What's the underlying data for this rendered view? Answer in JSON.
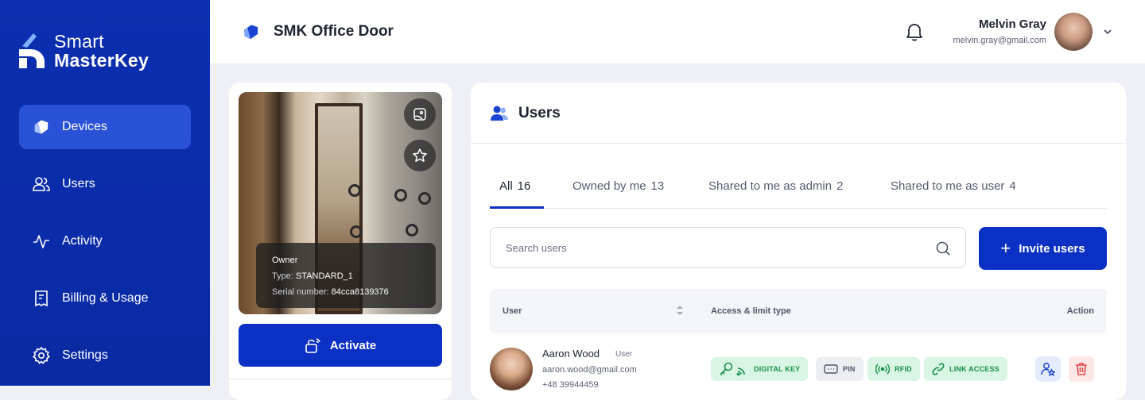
{
  "brand": {
    "line1": "Smart",
    "line2": "MasterKey"
  },
  "nav": {
    "items": [
      {
        "label": "Devices",
        "icon": "devices-icon",
        "active": true
      },
      {
        "label": "Users",
        "icon": "users-icon"
      },
      {
        "label": "Activity",
        "icon": "activity-icon"
      },
      {
        "label": "Billing & Usage",
        "icon": "billing-icon"
      },
      {
        "label": "Settings",
        "icon": "gear-icon"
      }
    ]
  },
  "header": {
    "device_title": "SMK Office Door",
    "user_name": "Melvin Gray",
    "user_email": "melvin.gray@gmail.com"
  },
  "device_card": {
    "owner_label": "Owner",
    "type_label": "Type:",
    "type_value": "STANDARD_1",
    "serial_label": "Serial number:",
    "serial_value": "84cca8139376",
    "activate_label": "Activate"
  },
  "users_panel": {
    "title": "Users",
    "tabs": [
      {
        "label": "All",
        "count": "16",
        "active": true
      },
      {
        "label": "Owned by me",
        "count": "13"
      },
      {
        "label": "Shared to me as admin",
        "count": "2"
      },
      {
        "label": "Shared to me as user",
        "count": "4"
      }
    ],
    "search_placeholder": "Search users",
    "invite_label": "Invite users",
    "columns": {
      "user": "User",
      "access": "Access & limit type",
      "action": "Action"
    },
    "rows": [
      {
        "name": "Aaron Wood",
        "role": "User",
        "email": "aaron.wood@gmail.com",
        "phone": "+48 39944459",
        "badges": [
          {
            "label": "DIGITAL KEY",
            "style": "green"
          },
          {
            "label": "PIN",
            "style": "gray"
          },
          {
            "label": "RFID",
            "style": "green"
          },
          {
            "label": "LINK ACCESS",
            "style": "green"
          }
        ]
      }
    ]
  },
  "colors": {
    "primary": "#0b30c4",
    "sidebar": "#0a2fb0",
    "success": "#15914a",
    "danger": "#e5484d"
  }
}
